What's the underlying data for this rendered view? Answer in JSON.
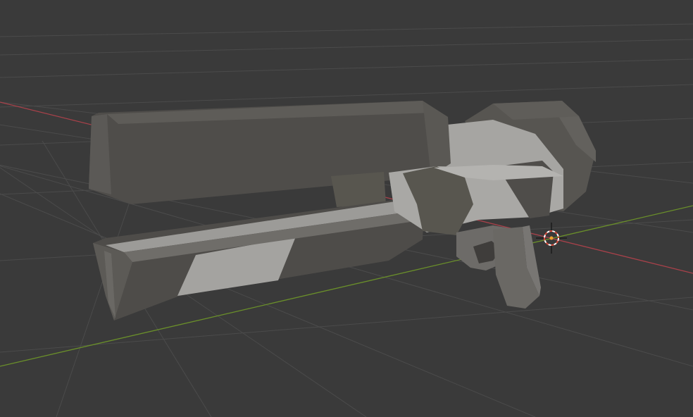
{
  "app": "Blender",
  "view": {
    "mode": "perspective",
    "shading": "solid",
    "background": "#3a3a3a",
    "grid_line_color": "#4a4a4a",
    "axis_x_color": "#c0404a",
    "axis_y_color": "#6a9a2a"
  },
  "scene": {
    "object_name": "",
    "object_type": "low-poly sci-fi rifle mesh",
    "materials": {
      "dark_gray": "#4e4c49",
      "mid_gray": "#6b6966",
      "light_gray": "#9c9b98",
      "highlight": "#b4b3b0"
    }
  },
  "cursor": {
    "icon": "3d-cursor-icon",
    "ring_colors": [
      "#d84a3a",
      "#ffffff"
    ]
  }
}
